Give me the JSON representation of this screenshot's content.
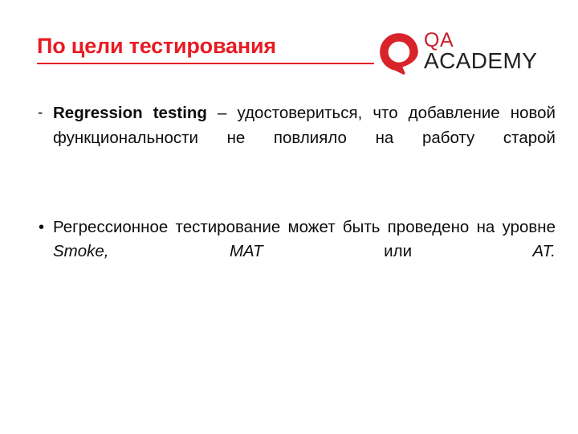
{
  "slide": {
    "title": "По цели тестирования",
    "title_color": "#e81b23",
    "background_color": "#ffffff",
    "body_text_color": "#0d0d0d"
  },
  "logo": {
    "mark_name": "qa-academy-q-mark",
    "mark_color": "#d8232a",
    "qa_text": "QA",
    "qa_color": "#c8202e",
    "academy_text": "ACADEMY",
    "academy_color": "#231f20"
  },
  "bullets": [
    {
      "marker": "-",
      "marker_type": "dash",
      "segments": [
        {
          "text": "Regression testing",
          "style": "bold"
        },
        {
          "text": " – удостовериться, что добавление новой функциональности не повлияло на работу старой",
          "style": "normal"
        }
      ]
    },
    {
      "marker": "•",
      "marker_type": "dot",
      "segments": [
        {
          "text": "Регрессионное тестирование может быть проведено на уровне ",
          "style": "normal"
        },
        {
          "text": "Smoke, MAT",
          "style": "italic"
        },
        {
          "text": " или ",
          "style": "normal"
        },
        {
          "text": "AT.",
          "style": "italic"
        }
      ]
    }
  ]
}
